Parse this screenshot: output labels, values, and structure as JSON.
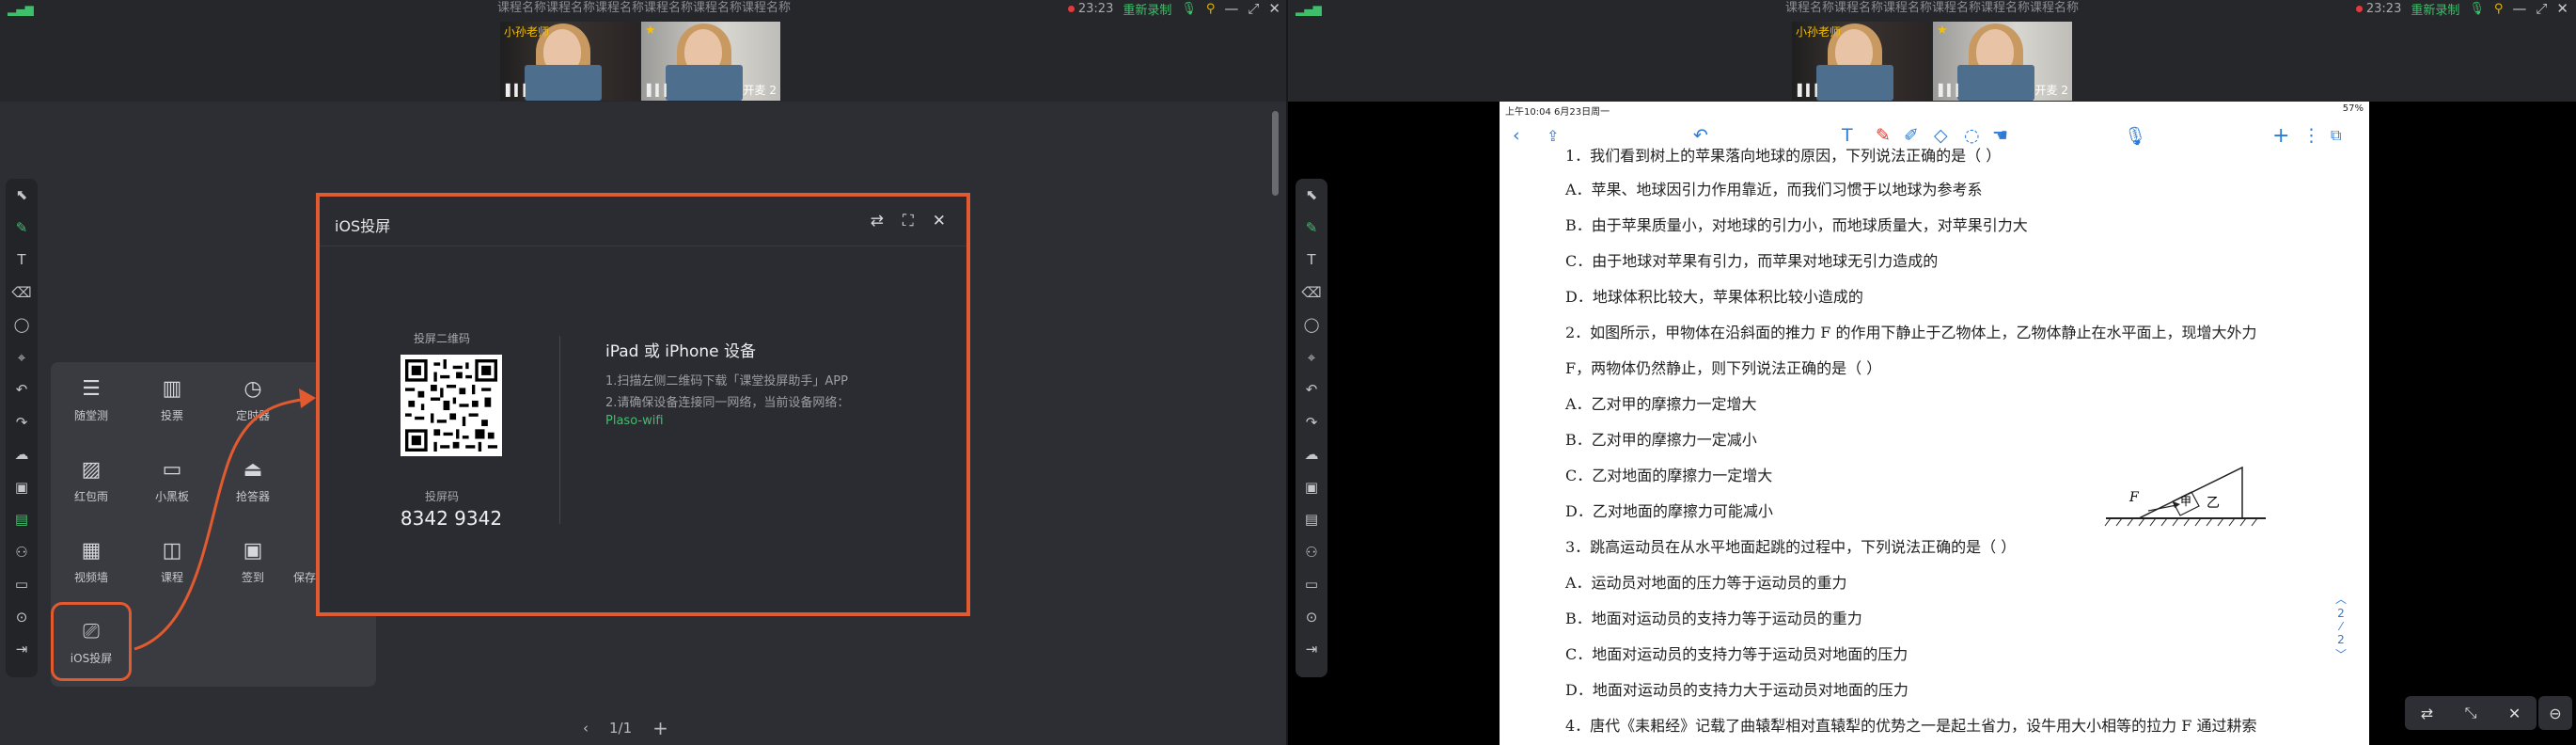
{
  "window": {
    "course_title": "课程名称课程名称课程名称课程名称课程名称课程名称",
    "time": "23:23",
    "reconnect": "重新录制"
  },
  "videos": [
    {
      "label": "小孙老师",
      "name": ""
    },
    {
      "label": "",
      "name": "开麦 2"
    }
  ],
  "tools": [
    {
      "label": "随堂测",
      "icon": "quiz-icon"
    },
    {
      "label": "投票",
      "icon": "vote-icon"
    },
    {
      "label": "定时器",
      "icon": "timer-icon"
    },
    {
      "label": "红包雨",
      "icon": "red-packet-icon"
    },
    {
      "label": "小黑板",
      "icon": "blackboard-icon"
    },
    {
      "label": "抢答器",
      "icon": "buzzer-icon"
    },
    {
      "label": "视频墙",
      "icon": "video-wall-icon"
    },
    {
      "label": "课程",
      "icon": "course-icon"
    },
    {
      "label": "签到",
      "icon": "checkin-icon"
    },
    {
      "label": "保存",
      "icon": "save-icon"
    },
    {
      "label": "iOS投屏",
      "icon": "screencast-icon"
    }
  ],
  "dialog": {
    "title": "iOS投屏",
    "qr_caption": "投屏二维码",
    "code_caption": "投屏码",
    "code": "8342 9342",
    "device_title": "iPad 或 iPhone 设备",
    "step1": "1.扫描左侧二维码下载「课堂投屏助手」APP",
    "step2": "2.请确保设备连接同一网络，当前设备网络：",
    "wifi": "Plaso-wifi"
  },
  "pager": {
    "text": "1/1"
  },
  "ipad": {
    "status_left": "上午10:04   6月23日周一",
    "status_right": "57%"
  },
  "doc_lines": [
    "1．我们看到树上的苹果落向地球的原因，下列说法正确的是（     ）",
    "A．苹果、地球因引力作用靠近，而我们习惯于以地球为参考系",
    "B．由于苹果质量小，对地球的引力小，而地球质量大，对苹果引力大",
    "C．由于地球对苹果有引力，而苹果对地球无引力造成的",
    "D．地球体积比较大，苹果体积比较小造成的",
    "2．如图所示，甲物体在沿斜面的推力 F 的作用下静止于乙物体上，乙物体静止在水平面上，现增大外力",
    "F，两物体仍然静止，则下列说法正确的是（    ）",
    "A．乙对甲的摩擦力一定增大",
    "B．乙对甲的摩擦力一定减小",
    "C．乙对地面的摩擦力一定增大",
    "D．乙对地面的摩擦力可能减小",
    "3．跳高运动员在从水平地面起跳的过程中，下列说法正确的是（      ）",
    "A．运动员对地面的压力等于运动员的重力",
    "B．地面对运动员的支持力等于运动员的重力",
    "C．地面对运动员的支持力等于运动员对地面的压力",
    "D．地面对运动员的支持力大于运动员对地面的压力",
    "4．唐代《耒耜经》记载了曲辕犁相对直辕犁的优势之一是起土省力，设牛用大小相等的拉力 F 通过耕索"
  ],
  "diagram": {
    "label_f": "F",
    "label_jia": "甲",
    "label_yi": "乙"
  },
  "page_indicator": {
    "current": "2",
    "total": "2"
  }
}
